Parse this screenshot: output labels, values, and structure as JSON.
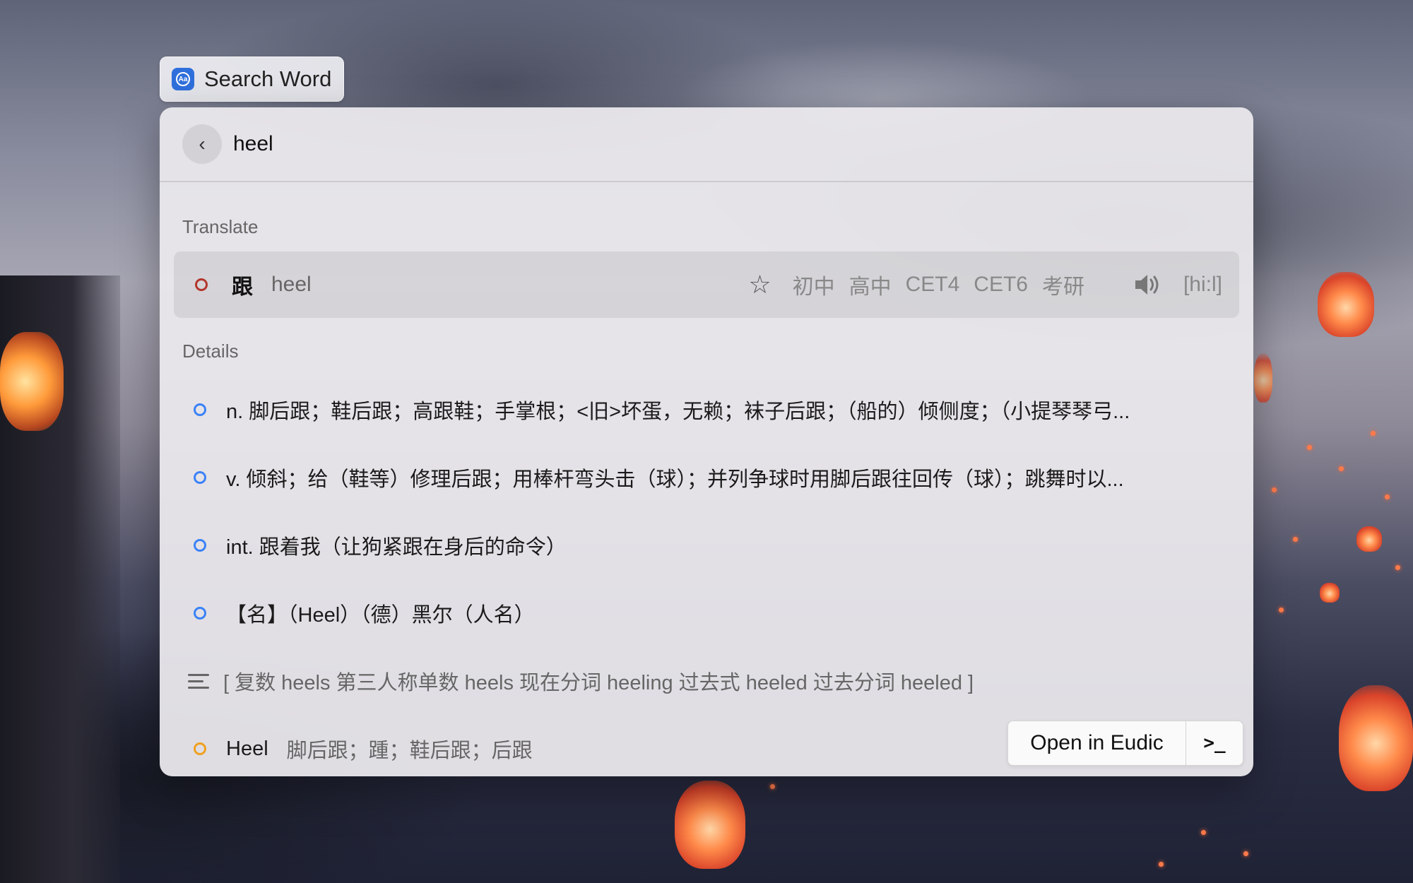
{
  "tag": {
    "label": "Search Word",
    "icon": "eudic-app-icon"
  },
  "search": {
    "query": "heel"
  },
  "sections": {
    "translate": "Translate",
    "details": "Details"
  },
  "translate": {
    "cn": "跟",
    "en": "heel",
    "levels": [
      "初中",
      "高中",
      "CET4",
      "CET6",
      "考研"
    ],
    "phonetic": "[hi:l]"
  },
  "details": [
    {
      "text": "n. 脚后跟；鞋后跟；高跟鞋；手掌根；<旧>坏蛋，无赖；袜子后跟；（船的）倾侧度；（小提琴琴弓..."
    },
    {
      "text": "v. 倾斜；给（鞋等）修理后跟；用棒杆弯头击（球）；并列争球时用脚后跟往回传（球）；跳舞时以..."
    },
    {
      "text": "int. 跟着我（让狗紧跟在身后的命令）"
    },
    {
      "text": "【名】（Heel）（德）黑尔（人名）"
    }
  ],
  "forms": "[ 复数 heels   第三人称单数 heels   现在分词 heeling   过去式 heeled   过去分词 heeled ]",
  "related": {
    "word": "Heel",
    "definition": "脚后跟；踵；鞋后跟；后跟"
  },
  "actions": {
    "open": "Open in Eudic",
    "terminal": ">_"
  },
  "colors": {
    "accent_red": "#b3362c",
    "accent_blue": "#3b82f6",
    "accent_orange": "#f0a020"
  }
}
